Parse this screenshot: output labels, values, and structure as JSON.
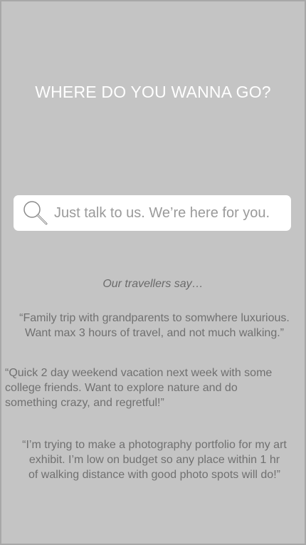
{
  "title": "WHERE DO YOU WANNA GO?",
  "search": {
    "placeholder": "Just talk to us. We’re here for you.",
    "icon": "search-icon"
  },
  "testimonials": {
    "heading": "Our travellers say…",
    "quotes": [
      "“Family trip with grandparents to somwhere luxurious.\nWant max 3 hours of travel, and not much walking.”",
      "“Quick 2 day weekend vacation next week with some\n   college friends. Want to explore nature and do\n   something crazy, and regretful!”",
      "“I’m trying to make a photography portfolio for my art\nexhibit. I’m low on budget so any place within 1 hr\nof walking distance with good photo spots will do!”"
    ]
  },
  "colors": {
    "background": "#c4c4c4",
    "title": "#ffffff",
    "text": "#707070"
  }
}
